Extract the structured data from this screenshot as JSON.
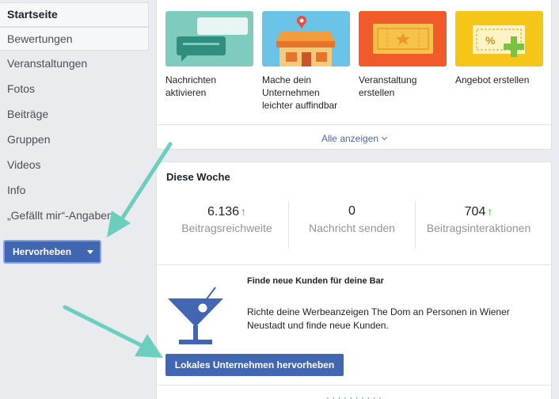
{
  "sidebar": {
    "items": [
      {
        "label": "Startseite"
      },
      {
        "label": "Bewertungen"
      },
      {
        "label": "Veranstaltungen"
      },
      {
        "label": "Fotos"
      },
      {
        "label": "Beiträge"
      },
      {
        "label": "Gruppen"
      },
      {
        "label": "Videos"
      },
      {
        "label": "Info"
      },
      {
        "label": "„Gefällt mir“-Angaben"
      }
    ],
    "promote_label": "Hervorheben"
  },
  "actions": {
    "tiles": [
      {
        "label": "Nachrichten aktivieren",
        "icon": "chat-bubbles-icon",
        "color": "#7fcbbd"
      },
      {
        "label": "Mache dein Unternehmen leichter auffindbar",
        "icon": "storefront-pin-icon",
        "color": "#6cc3e8"
      },
      {
        "label": "Veranstaltung erstellen",
        "icon": "ticket-star-icon",
        "color": "#f15b2a"
      },
      {
        "label": "Angebot erstellen",
        "icon": "coupon-percent-icon",
        "color": "#f5c518"
      }
    ],
    "see_all": "Alle anzeigen"
  },
  "week": {
    "title": "Diese Woche",
    "stats": [
      {
        "value": "6.136",
        "label": "Beitragsreichweite",
        "trend": "up"
      },
      {
        "value": "0",
        "label": "Nachricht senden",
        "trend": "none"
      },
      {
        "value": "704",
        "label": "Beitragsinteraktionen",
        "trend": "up"
      }
    ]
  },
  "promo": {
    "title": "Finde neue Kunden für deine Bar",
    "text": "Richte deine Werbeanzeigen The Dom an Personen in Wiener Neustadt und finde neue Kunden.",
    "button": "Lokales Unternehmen hervorheben",
    "icon": "cocktail-glass-icon"
  },
  "colors": {
    "brand_blue": "#4267b2",
    "arrow": "#6ccfbe",
    "trend_up": "#42b72a"
  }
}
